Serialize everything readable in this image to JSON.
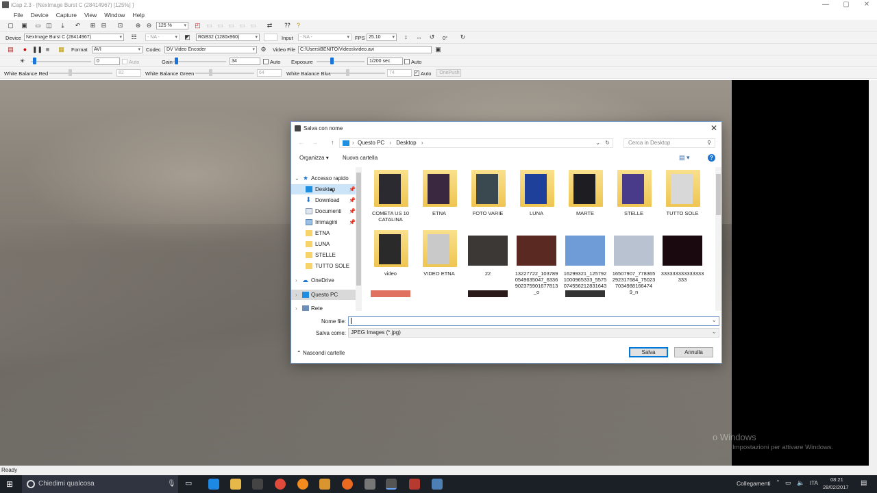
{
  "window": {
    "title": "iCap 2.3 - [NexImage Burst C (28414967) [125%] ]",
    "minimize": "—",
    "maximize": "▢",
    "close": "✕"
  },
  "menu": [
    "File",
    "Device",
    "Capture",
    "View",
    "Window",
    "Help"
  ],
  "toolbar1": {
    "zoom": "125 %"
  },
  "toolbar2": {
    "device_label": "Device",
    "device_value": "NexImage Burst C (28414967)",
    "na1": "- NA -",
    "format_value": "RGB32 (1280x960)",
    "input_label": "Input",
    "input_value": "- NA -",
    "fps_label": "FPS",
    "fps_value": "25.10",
    "rot_value": "0°"
  },
  "toolbar3": {
    "format_label": "Format",
    "format_value": "AVI",
    "codec_label": "Codec",
    "codec_value": "DV Video Encoder",
    "videofile_label": "Video File",
    "videofile_value": "C:\\Users\\BENITO\\Videos\\video.avi"
  },
  "toolbar4": {
    "brightness_value": "0",
    "auto1": "Auto",
    "gain_label": "Gain",
    "gain_value": "34",
    "auto2": "Auto",
    "exposure_label": "Exposure",
    "exposure_value": "1/200 sec",
    "auto3": "Auto"
  },
  "toolbar5": {
    "wbr_label": "White Balance Red",
    "wbr_value": "82",
    "wbg_label": "White Balance Green",
    "wbg_value": "64",
    "wbb_label": "White Balance Blue",
    "wbb_value": "74",
    "auto": "Auto",
    "onepush": "OnePush"
  },
  "status": {
    "text": "Ready"
  },
  "watermark": {
    "line1": "o Windows",
    "line2": "Impostazioni per attivare Windows."
  },
  "taskbar": {
    "search_placeholder": "Chiedimi qualcosa",
    "collegamenti": "Collegamenti",
    "lang": "ITA",
    "time": "08:21",
    "date": "28/02/2017"
  },
  "colors": {
    "accent": "#0078d7",
    "folder": "#f6d36b",
    "taskbar": "#1b1f26"
  },
  "dialog": {
    "title": "Salva con nome",
    "breadcrumb": [
      "Questo PC",
      "Desktop"
    ],
    "search_placeholder": "Cerca in Desktop",
    "organize": "Organizza",
    "new_folder": "Nuova cartella",
    "nav": {
      "quick": "Accesso rapido",
      "items": [
        "Desktop",
        "Download",
        "Documenti",
        "Immagini",
        "ETNA",
        "LUNA",
        "STELLE",
        "TUTTO SOLE"
      ],
      "onedrive": "OneDrive",
      "pc": "Questo PC",
      "rete": "Rete"
    },
    "files": [
      {
        "name": "COMETA US 10 CATALINA",
        "kind": "folder",
        "tint": "#2a2a30"
      },
      {
        "name": "ETNA",
        "kind": "folder",
        "tint": "#3a2840"
      },
      {
        "name": "FOTO VARIE",
        "kind": "folder",
        "tint": "#3a4850"
      },
      {
        "name": "LUNA",
        "kind": "folder",
        "tint": "#1e3f9a"
      },
      {
        "name": "MARTE",
        "kind": "folder",
        "tint": "#1d1d22"
      },
      {
        "name": "STELLE",
        "kind": "folder",
        "tint": "#4a3a8a"
      },
      {
        "name": "TUTTO SOLE",
        "kind": "folder",
        "tint": "#d8d8d8"
      },
      {
        "name": "video",
        "kind": "folder",
        "tint": "#2a2a2a"
      },
      {
        "name": "VIDEO ETNA",
        "kind": "folder",
        "tint": "#c9c9c9"
      },
      {
        "name": "22",
        "kind": "image",
        "tint": "#3b3835"
      },
      {
        "name": "13227722_1037890549635047_6336902375901677813_o",
        "kind": "image",
        "tint": "#5a2a22"
      },
      {
        "name": "16299321_1257921000965333_5575074556212831643_n",
        "kind": "image",
        "tint": "#6f9bd6"
      },
      {
        "name": "16507907_778365292317684_750237034988166474​9_n",
        "kind": "image",
        "tint": "#b8c2d0"
      },
      {
        "name": "333333333333333333",
        "kind": "image",
        "tint": "#1a0a10"
      }
    ],
    "filename_label": "Nome file:",
    "filename_value": "",
    "saveas_label": "Salva come:",
    "saveas_value": "JPEG Images (*.jpg)",
    "hide_folders": "Nascondi cartelle",
    "save": "Salva",
    "cancel": "Annulla"
  }
}
